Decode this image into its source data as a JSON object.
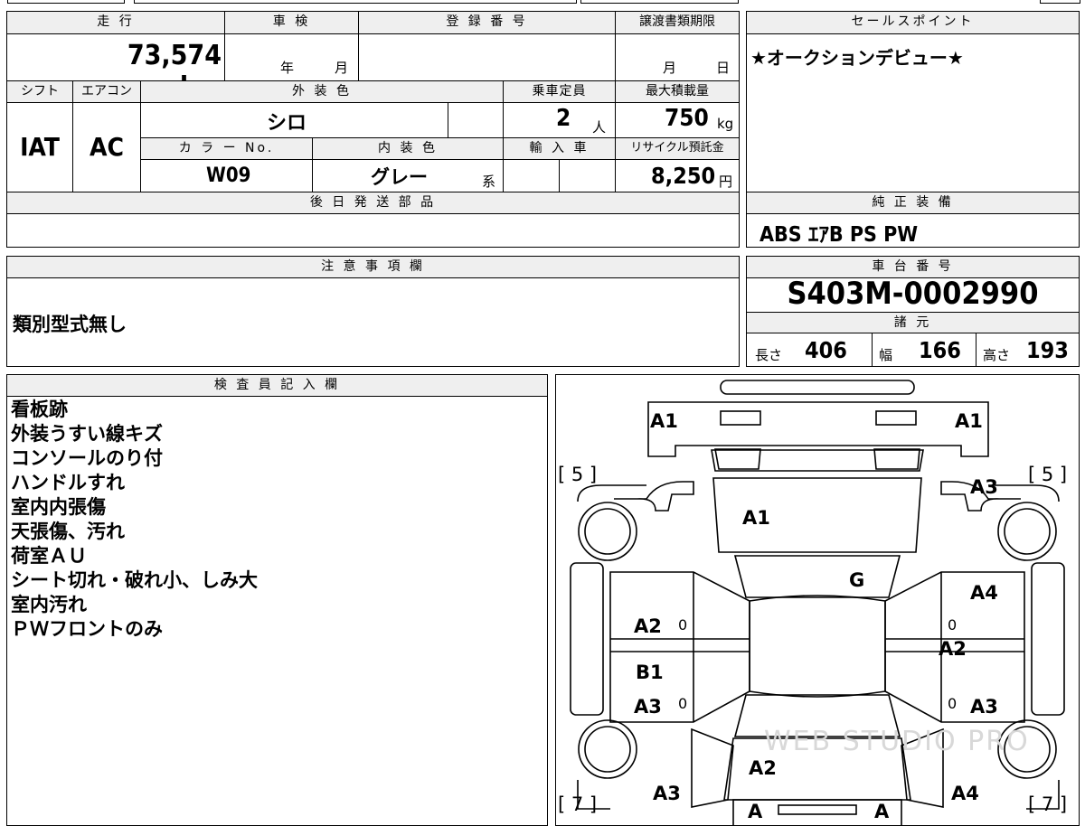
{
  "vehicle": {
    "mileage_label": "走 行",
    "mileage_value": "73,574 km",
    "inspection_label": "車 検",
    "inspection_year": "年",
    "inspection_month": "月",
    "registration_label": "登 録 番 号",
    "transfer_label": "譲渡書類期限",
    "transfer_month": "月",
    "transfer_day": "日",
    "shift_label": "シフト",
    "shift_value": "IAT",
    "ac_label": "エアコン",
    "ac_value": "AC",
    "exterior_color_label": "外 装 色",
    "exterior_color_value": "シロ",
    "color_no_label": "カ ラ ー No.",
    "color_no_value": "W09",
    "interior_color_label": "内 装 色",
    "interior_color_value": "グレー",
    "interior_color_suffix": "系",
    "capacity_label": "乗車定員",
    "capacity_value": "2",
    "capacity_unit": "人",
    "max_load_label": "最大積載量",
    "max_load_value": "750",
    "max_load_unit": "kg",
    "import_label": "輸 入 車",
    "recycle_label": "リサイクル預託金",
    "recycle_value": "8,250",
    "recycle_unit": "円",
    "later_parts_label": "後 日 発 送 部 品"
  },
  "sales_point": {
    "label": "セールスポイント",
    "text": "★オークションデビュー★"
  },
  "equipment": {
    "label": "純 正 装 備",
    "text": "ABS ｴｱB PS PW"
  },
  "notes": {
    "label": "注 意 事 項 欄",
    "text": "類別型式無し"
  },
  "chassis": {
    "label": "車 台 番 号",
    "value": "S403M-0002990",
    "specs_label": "諸 元",
    "length_label": "長さ",
    "length_value": "406",
    "width_label": "幅",
    "width_value": "166",
    "height_label": "高さ",
    "height_value": "193"
  },
  "inspector": {
    "label": "検 査 員 記 入 欄",
    "lines": [
      "看板跡",
      "外装うすい線キズ",
      "コンソールのり付",
      "ハンドルすれ",
      "室内内張傷",
      "天張傷、汚れ",
      "荷室ＡＵ",
      "シート切れ・破れ小、しみ大",
      "室内汚れ",
      "ＰＷフロントのみ"
    ]
  },
  "diagram": {
    "marks": {
      "a1_left": "A1",
      "a1_right": "A1",
      "a3_front_right": "A3",
      "a1_hood": "A1",
      "g_windshield": "G",
      "a4_right_front": "A4",
      "a2_left_front": "A2",
      "a2_right": "A2",
      "b1_left": "B1",
      "a3_left_rear": "A3",
      "a3_right_rear": "A3",
      "a2_roof": "A2",
      "a3_left_bottom": "A3",
      "a4_right_bottom": "A4",
      "a_bottom_left": "A",
      "a_bottom_right": "A"
    },
    "tire_front_left": "[ 5 ]",
    "tire_front_right": "[ 5 ]",
    "tire_rear_left": "[ 7 ]",
    "tire_rear_right": "[ 7 ]",
    "zero": "0",
    "watermark": "WEB STUDIO PRO"
  }
}
